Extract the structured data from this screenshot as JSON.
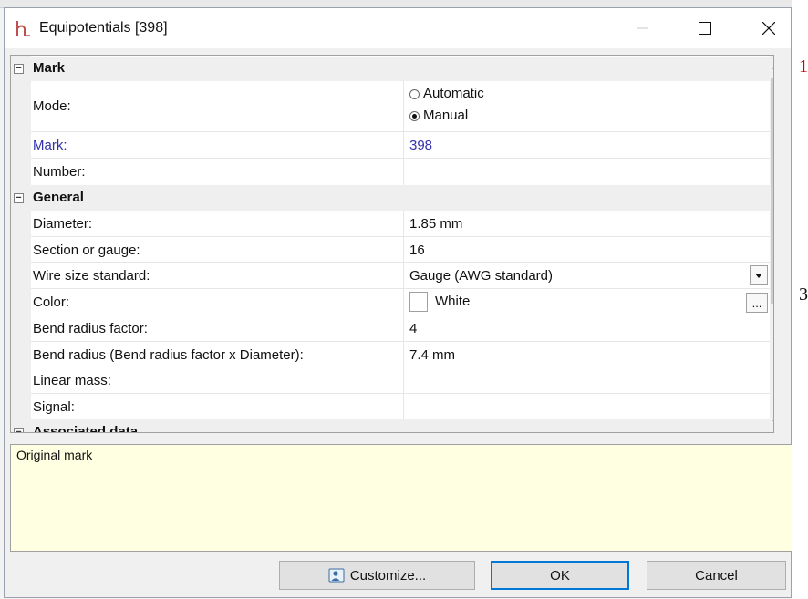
{
  "window": {
    "title": "Equipotentials [398]"
  },
  "background": {
    "marks": [
      "1",
      "3"
    ]
  },
  "categories": {
    "mark": "Mark",
    "general": "General",
    "associated": "Associated data"
  },
  "mode": {
    "label": "Mode:",
    "options": [
      "Automatic",
      "Manual"
    ],
    "selected": "Manual"
  },
  "properties": {
    "mark_label": "Mark:",
    "mark_value": "398",
    "number_label": "Number:",
    "number_value": "",
    "diameter_label": "Diameter:",
    "diameter_value": "1.85 mm",
    "section_label": "Section or gauge:",
    "section_value": "16",
    "wire_std_label": "Wire size standard:",
    "wire_std_value": "Gauge (AWG standard)",
    "color_label": "Color:",
    "color_value": "White",
    "color_swatch": "#ffffff",
    "bend_factor_label": "Bend radius factor:",
    "bend_factor_value": "4",
    "bend_radius_label": "Bend radius (Bend radius factor x Diameter):",
    "bend_radius_value": "7.4 mm",
    "linear_mass_label": "Linear mass:",
    "linear_mass_value": "",
    "signal_label": "Signal:",
    "signal_value": ""
  },
  "description": {
    "text": "Original mark"
  },
  "buttons": {
    "customize": "Customize...",
    "ok": "OK",
    "cancel": "Cancel",
    "ellipsis": "..."
  },
  "colors": {
    "accent": "#0078d7",
    "changed_text": "#3333aa",
    "desc_bg": "#ffffe1",
    "red_mark": "#cc0000"
  }
}
